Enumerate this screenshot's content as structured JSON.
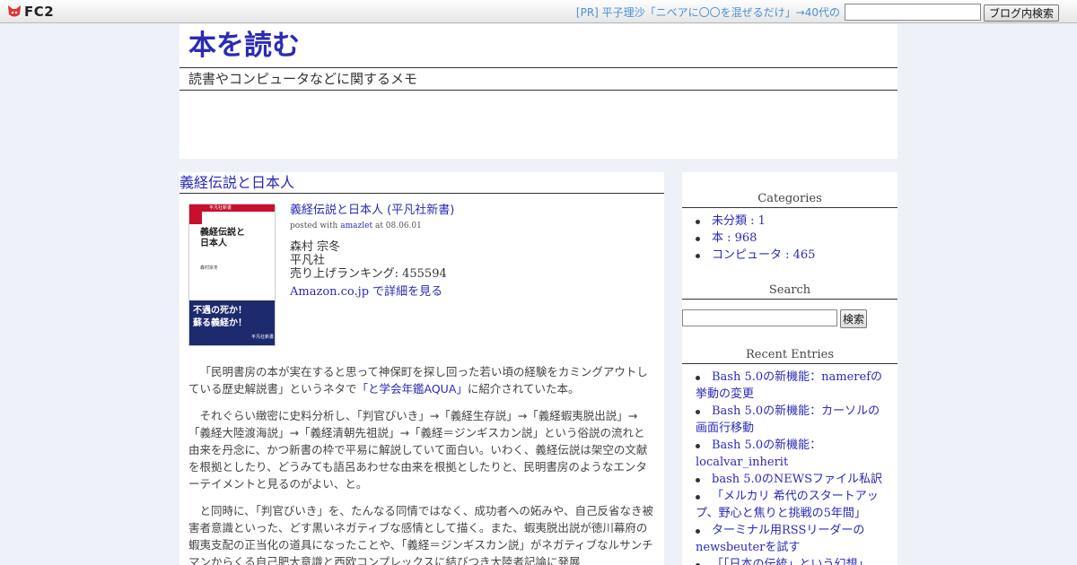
{
  "fc2bar": {
    "logo_text": "FC2",
    "pr_text": "[PR] 平子理沙「ニベアに〇〇を混ぜるだけ」→40代の",
    "search_button": "ブログ内検索"
  },
  "header": {
    "title": "本を読む",
    "description": "読書やコンピュータなどに関するメモ"
  },
  "entry": {
    "title": "義経伝説と日本人",
    "book": {
      "link_text": "義経伝説と日本人 (平凡社新書)",
      "posted_prefix": "posted with",
      "posted_tool": "amazlet",
      "posted_suffix": "at 08.06.01",
      "author": "森村 宗冬",
      "publisher": "平凡社",
      "ranking": "売り上げランキング: 455594",
      "amazon_link": "Amazon.co.jp で詳細を見る",
      "cover": {
        "series": "平凡社新書",
        "title_line1": "義経伝説と",
        "title_line2": "日本人",
        "author": "森村宗冬",
        "copy_line1": "不遇の死か！",
        "copy_line2": "蘇る義経か！",
        "publisher": "平凡社新書"
      }
    },
    "paragraph1_a": "「民明書房の本が実在すると思って神保町を探し回った若い頃の経験をカミングアウトしている歴史解説書」というネタで",
    "paragraph1_link": "「と学会年鑑AQUA」",
    "paragraph1_b": "に紹介されていた本。",
    "paragraph2": "それぐらい緻密に史料分析し、「判官びいき」→「義経生存説」→「義経蝦夷脱出説」→「義経大陸渡海説」→「義経清朝先祖説」→「義経＝ジンギスカン説」という俗説の流れと由来を丹念に、かつ新書の枠で平易に解説していて面白い。いわく、義経伝説は架空の文献を根拠としたり、どうみても語呂あわせな由来を根拠としたりと、民明書房のようなエンターテイメントと見るのがよい、と。",
    "paragraph3": "と同時に、「判官びいき」を、たんなる同情ではなく、成功者への妬みや、自己反省なき被害者意識といった、どす黒いネガティブな感情として描く。また、蝦夷脱出説が徳川幕府の蝦夷支配の正当化の道具になったことや、「義経＝ジンギスカン説」がネガティブなルサンチマンからくる自己肥大意識と西欧コンプレックスに結びつき大陸者記論に発展"
  },
  "sidebar": {
    "categories_heading": "Categories",
    "categories": [
      {
        "label": "未分類 : 1"
      },
      {
        "label": "本 : 968"
      },
      {
        "label": "コンピュータ : 465"
      }
    ],
    "search_heading": "Search",
    "search_button": "検索",
    "recent_heading": "Recent Entries",
    "recent": [
      {
        "label": "Bash 5.0の新機能：namerefの挙動の変更"
      },
      {
        "label": "Bash 5.0の新機能：カーソルの画面行移動"
      },
      {
        "label": "Bash 5.0の新機能：localvar_inherit"
      },
      {
        "label": "bash 5.0のNEWSファイル私訳"
      },
      {
        "label": "「メルカリ 希代のスタートアップ、野心と焦りと挑戦の5年間」"
      },
      {
        "label": "ターミナル用RSSリーダーのnewsbeuterを試す"
      },
      {
        "label": "「「日本の伝統」という幻想」"
      }
    ]
  },
  "colors": {
    "link": "#2a2ab8",
    "pr_link": "#4a8fd6",
    "page_background": "#eef2f8"
  }
}
